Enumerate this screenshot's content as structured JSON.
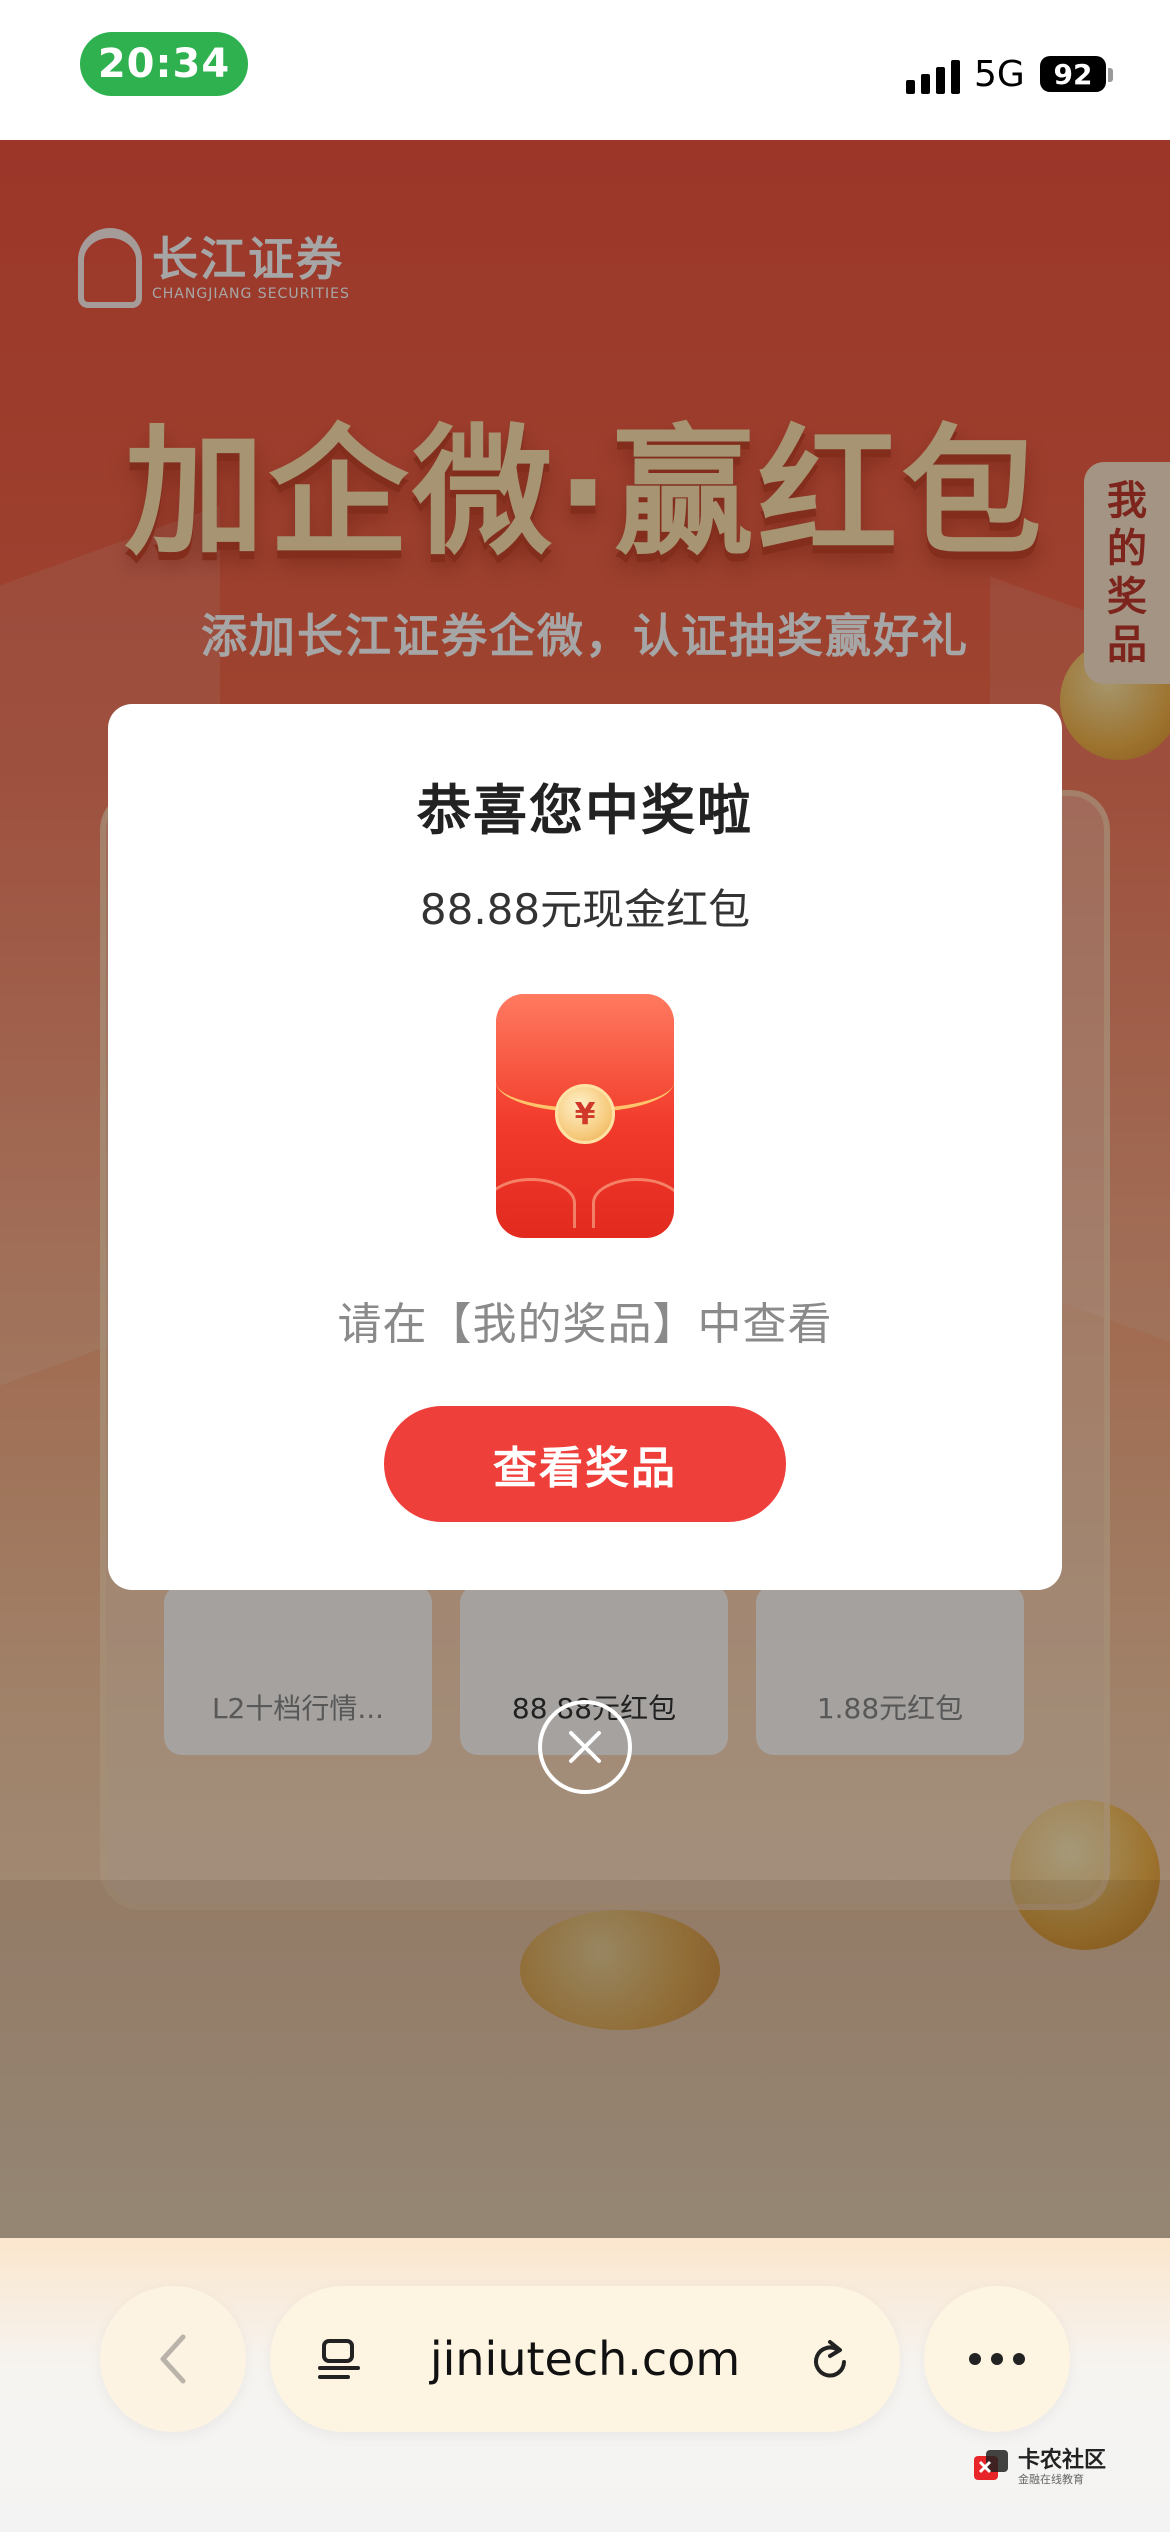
{
  "status_bar": {
    "time": "20:34",
    "network": "5G",
    "battery": "92"
  },
  "background": {
    "brand_cn": "长江证券",
    "brand_en": "CHANGJIANG SECURITIES",
    "headline": "加企微·赢红包",
    "subline": "添加长江证券企微，认证抽奖赢好礼",
    "my_prize_tab": [
      "我",
      "的",
      "奖",
      "品"
    ],
    "prizes": [
      {
        "label": "L2十档行情..."
      },
      {
        "label": "88.88元红包"
      },
      {
        "label": "1.88元红包"
      }
    ]
  },
  "modal": {
    "title": "恭喜您中奖啦",
    "amount": "88.88元现金红包",
    "envelope_symbol": "¥",
    "hint": "请在【我的奖品】中查看",
    "button": "查看奖品",
    "close_icon": "close-icon"
  },
  "browser": {
    "url": "jiniutech.com",
    "back_icon": "chevron-left-icon",
    "tabs_icon": "reader-icon",
    "reload_icon": "reload-icon",
    "more_icon": "more-icon"
  },
  "watermark": {
    "main": "卡农社区",
    "sub": "金融在线教育"
  },
  "colors": {
    "accent_red": "#ef3f3a",
    "status_green": "#2fb14f"
  }
}
